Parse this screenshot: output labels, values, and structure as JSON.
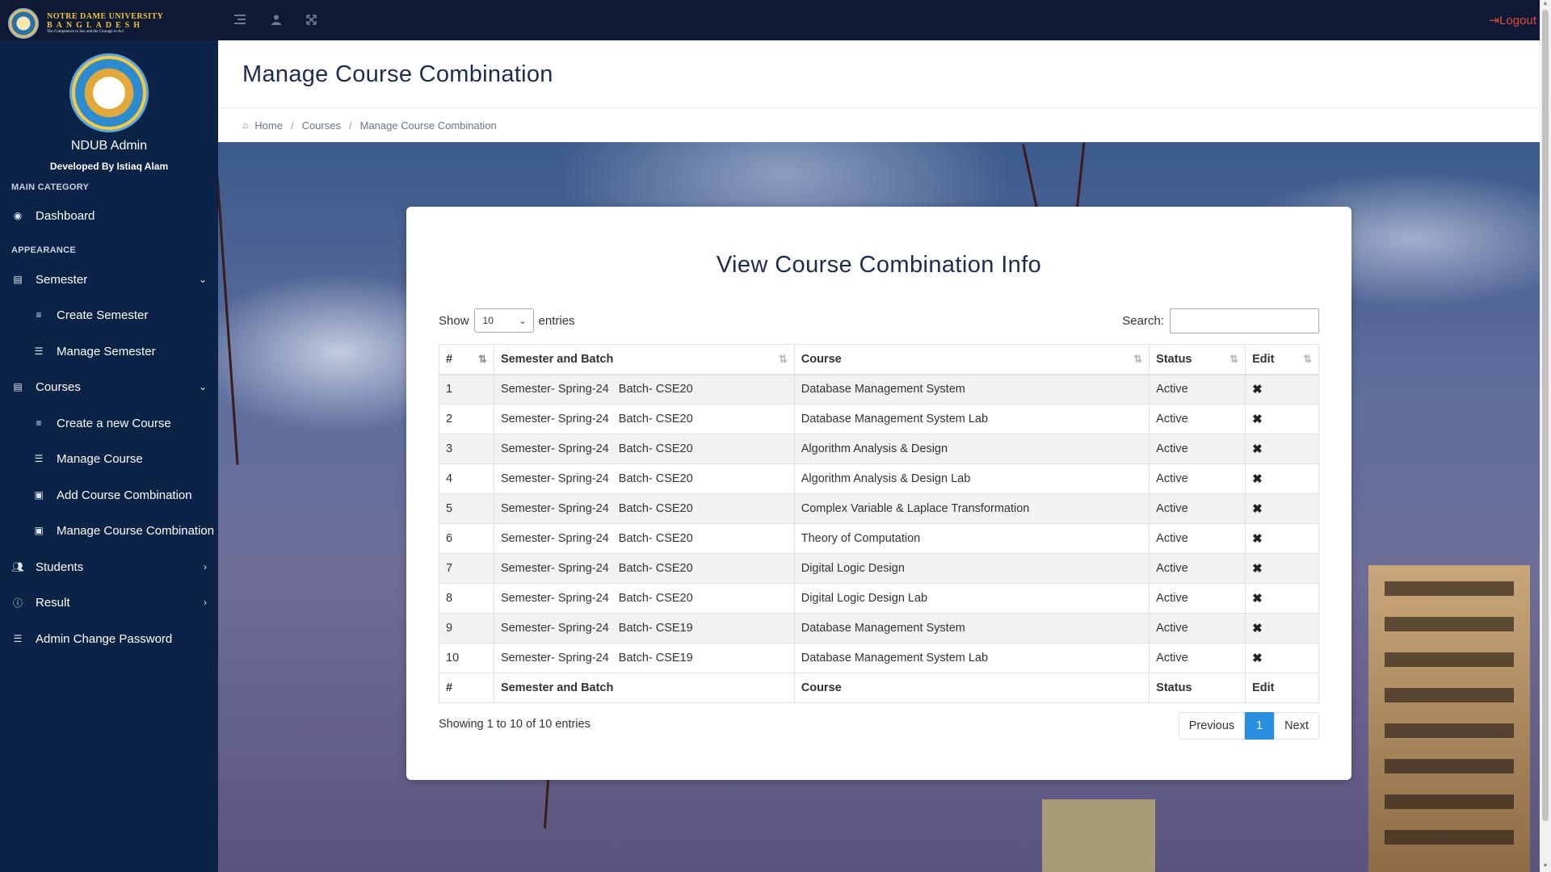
{
  "brand": {
    "line1": "NOTRE DAME UNIVERSITY",
    "line2": "BANGLADESH",
    "line3": "The Competence to See and the Courage to Act"
  },
  "topbar": {
    "logout_label": "Logout"
  },
  "sidebar": {
    "admin_name": "NDUB Admin",
    "developer": "Developed By Istiaq Alam",
    "main_category_label": "MAIN CATEGORY",
    "appearance_label": "APPEARANCE",
    "items": [
      {
        "label": "Dashboard",
        "icon": "dashboard-icon"
      },
      {
        "label": "Semester",
        "icon": "file-icon"
      },
      {
        "label": "Create Semester",
        "icon": "list-icon"
      },
      {
        "label": "Manage Semester",
        "icon": "table-icon"
      },
      {
        "label": "Courses",
        "icon": "file-icon"
      },
      {
        "label": "Create a new Course",
        "icon": "list-icon"
      },
      {
        "label": "Manage Course",
        "icon": "table-icon"
      },
      {
        "label": "Add Course Combination",
        "icon": "id-card-icon"
      },
      {
        "label": "Manage Course Combination",
        "icon": "id-card-icon"
      },
      {
        "label": "Students",
        "icon": "users-icon"
      },
      {
        "label": "Result",
        "icon": "info-icon"
      },
      {
        "label": "Admin Change Password",
        "icon": "server-icon"
      }
    ]
  },
  "page": {
    "title": "Manage Course Combination",
    "breadcrumb": [
      "Home",
      "Courses",
      "Manage Course Combination"
    ]
  },
  "card": {
    "title": "View Course Combination Info",
    "show_label": "Show",
    "entries_label": "entries",
    "page_length": "10",
    "search_label": "Search:",
    "search_value": "",
    "columns": [
      "#",
      "Semester and Batch",
      "Course",
      "Status",
      "Edit"
    ],
    "rows": [
      {
        "num": "1",
        "semester_batch": "Semester- Spring-24   Batch- CSE20",
        "course": "Database Management System",
        "status": "Active"
      },
      {
        "num": "2",
        "semester_batch": "Semester- Spring-24   Batch- CSE20",
        "course": "Database Management System Lab",
        "status": "Active"
      },
      {
        "num": "3",
        "semester_batch": "Semester- Spring-24   Batch- CSE20",
        "course": "Algorithm Analysis & Design",
        "status": "Active"
      },
      {
        "num": "4",
        "semester_batch": "Semester- Spring-24   Batch- CSE20",
        "course": "Algorithm Analysis & Design Lab",
        "status": "Active"
      },
      {
        "num": "5",
        "semester_batch": "Semester- Spring-24   Batch- CSE20",
        "course": "Complex Variable & Laplace Transformation",
        "status": "Active"
      },
      {
        "num": "6",
        "semester_batch": "Semester- Spring-24   Batch- CSE20",
        "course": "Theory of Computation",
        "status": "Active"
      },
      {
        "num": "7",
        "semester_batch": "Semester- Spring-24   Batch- CSE20",
        "course": "Digital Logic Design",
        "status": "Active"
      },
      {
        "num": "8",
        "semester_batch": "Semester- Spring-24   Batch- CSE20",
        "course": "Digital Logic Design Lab",
        "status": "Active"
      },
      {
        "num": "9",
        "semester_batch": "Semester- Spring-24   Batch- CSE19",
        "course": "Database Management System",
        "status": "Active"
      },
      {
        "num": "10",
        "semester_batch": "Semester- Spring-24   Batch- CSE19",
        "course": "Database Management System Lab",
        "status": "Active"
      }
    ],
    "info": "Showing 1 to 10 of 10 entries",
    "pager": {
      "previous": "Previous",
      "current": "1",
      "next": "Next"
    }
  },
  "colors": {
    "sidebar_bg": "#0b2347",
    "topbar_bg": "#0e1a35",
    "accent": "#2b8fdf",
    "logout": "#e04a3f"
  }
}
